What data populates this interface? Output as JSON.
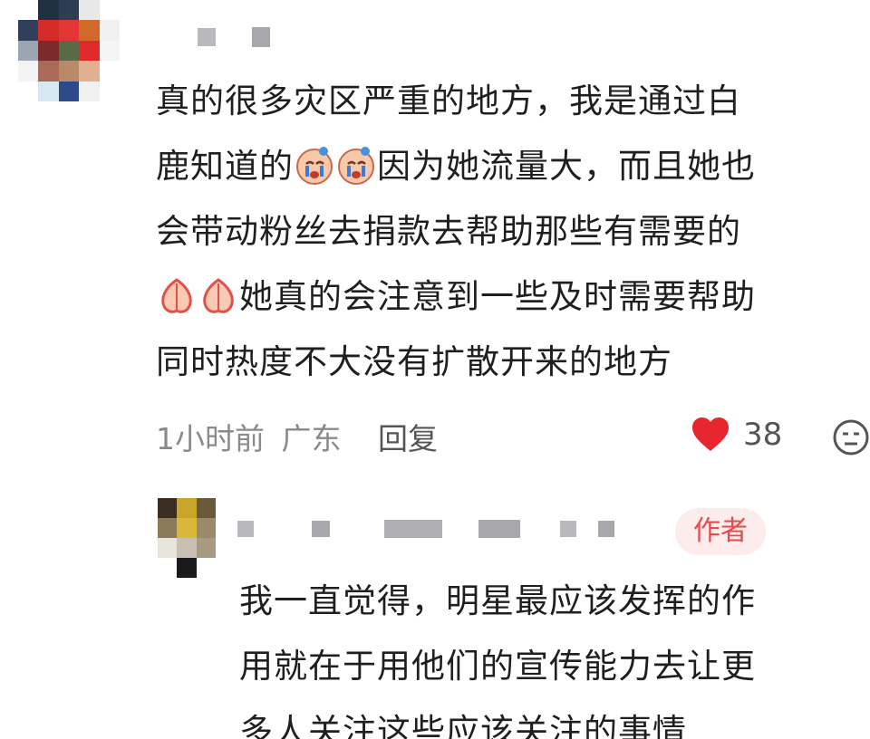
{
  "comment": {
    "lines": [
      "真的很多灾区严重的地方，我是通过白",
      "鹿知道的",
      "因为她流量大，而且她也",
      "会带动粉丝去捐款去帮助那些有需要的",
      "她真的会注意到一些及时需要帮助",
      "同时热度不大没有扩散开来的地方"
    ],
    "time": "1小时前",
    "location": "广东",
    "reply_label": "回复",
    "like_count": "38",
    "icons": [
      "crying-face-icon",
      "crying-face-icon",
      "clasped-hands-icon",
      "clasped-hands-icon",
      "heart-icon",
      "dislike-face-icon"
    ]
  },
  "reply": {
    "badge": "作者",
    "lines": [
      "我一直觉得，明星最应该发挥的作",
      "用就在于用他们的宣传能力去让更",
      "多人关注这些应该关注的事情"
    ]
  },
  "colors": {
    "heart": "#e8262f",
    "badge_bg": "#fdecec",
    "badge_text": "#e64a4a",
    "meta": "#8a8a8a"
  }
}
